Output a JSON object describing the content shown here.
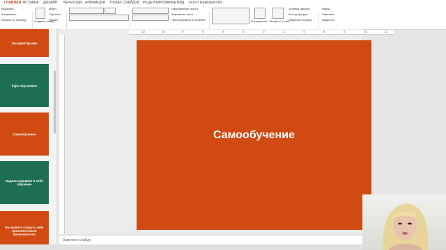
{
  "tabs": [
    "ГЛАВНАЯ",
    "ВСТАВКА",
    "ДИЗАЙН",
    "ПЕРЕХОДЫ",
    "АНИМАЦИЯ",
    "ПОКАЗ СЛАЙДОВ",
    "РЕЦЕНЗИРОВАНИЕ",
    "ВИД",
    "FOXIT READER PDF"
  ],
  "ribbon": {
    "clipboard": {
      "cut": "Вырезать",
      "copy": "Копировать",
      "format": "Формат по образцу",
      "label": "Буфер обмена"
    },
    "slides": {
      "new_slide": "Создать слайд",
      "layout": "Макет",
      "reset": "Сбросить",
      "section": "Раздел",
      "label": "Слайды"
    },
    "font": {
      "label": "Шрифт"
    },
    "paragraph": {
      "direction": "Направление текста",
      "align": "Выровнять текст",
      "smartart": "Преобразовать в SmartArt",
      "label": "Абзац"
    },
    "drawing": {
      "arrange": "Упорядочить",
      "styles": "Экспресс-стили",
      "fill": "Заливка фигуры",
      "outline": "Контур фигуры",
      "effects": "Эффекты фигуры",
      "label": "Рисование"
    },
    "editing": {
      "find": "Найти",
      "replace": "Заменить",
      "select": "Выделить",
      "label": "Редактирование"
    }
  },
  "thumbnails": [
    {
      "text": "Онлайн/Офлайн",
      "color": "#d04a11"
    },
    {
      "text": "Курс под запрос",
      "color": "#1e6e56"
    },
    {
      "text": "Самообучение",
      "color": "#d04a11"
    },
    {
      "text": "Задача содержит в себе обучение",
      "color": "#1e6e56"
    },
    {
      "text": "Вы можете создать себе дополнительно промежуточно",
      "color": "#d04a11"
    }
  ],
  "ruler_numbers": [
    "12",
    "10",
    "8",
    "6",
    "4",
    "2",
    "0",
    "2",
    "4",
    "6",
    "8",
    "10",
    "12"
  ],
  "slide": {
    "title": "Самообучение"
  },
  "notes": {
    "placeholder": "Заметки к слайду"
  }
}
